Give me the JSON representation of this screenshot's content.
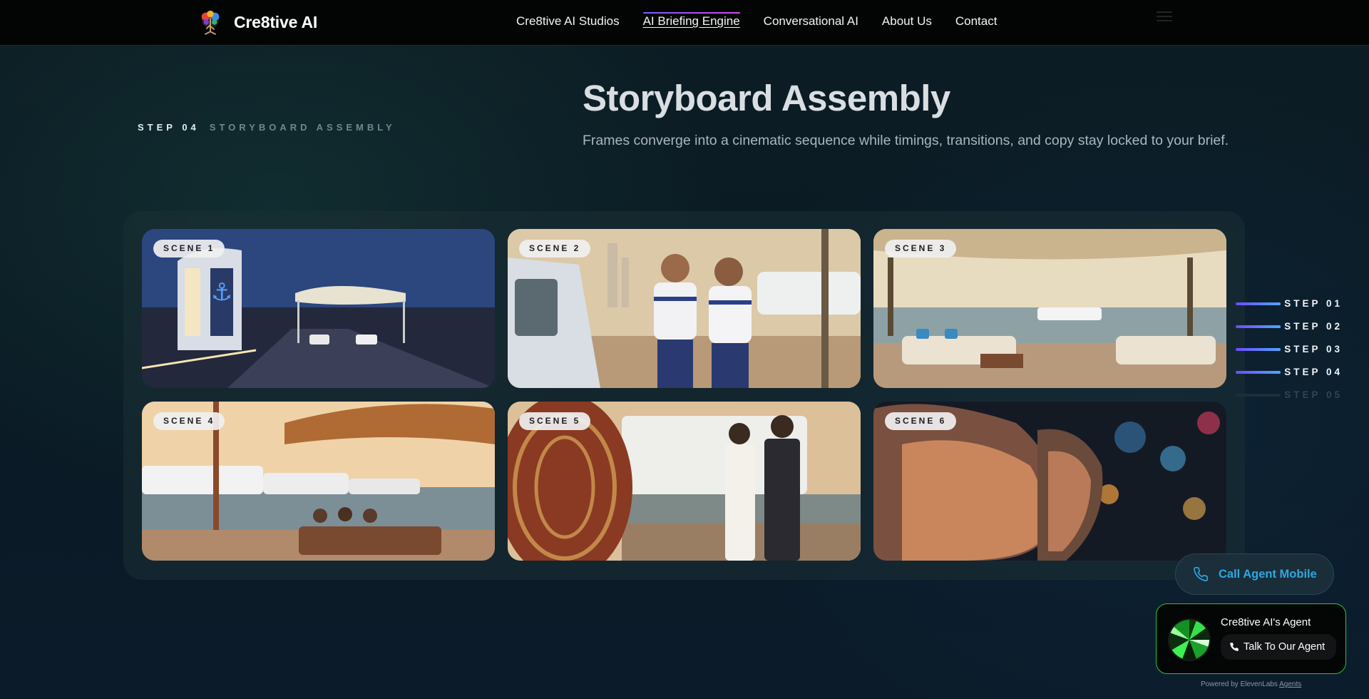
{
  "nav": {
    "brand": "Cre8tive AI",
    "links": [
      {
        "label": "Cre8tive AI Studios"
      },
      {
        "label": "AI Briefing Engine",
        "active": true
      },
      {
        "label": "Conversational AI"
      },
      {
        "label": "About Us"
      },
      {
        "label": "Contact"
      }
    ]
  },
  "section": {
    "step_number": "STEP 04",
    "step_label": "STORYBOARD ASSEMBLY",
    "title": "Storyboard Assembly",
    "subtitle": "Frames converge into a cinematic sequence while timings, transitions, and copy stay locked to your brief."
  },
  "scenes": [
    {
      "label": "SCENE 1"
    },
    {
      "label": "SCENE 2"
    },
    {
      "label": "SCENE 3"
    },
    {
      "label": "SCENE 4"
    },
    {
      "label": "SCENE 5"
    },
    {
      "label": "SCENE 6"
    }
  ],
  "steps": [
    {
      "label": "STEP 01",
      "active": true
    },
    {
      "label": "STEP 02",
      "active": true
    },
    {
      "label": "STEP 03",
      "active": true
    },
    {
      "label": "STEP 04",
      "active": true
    },
    {
      "label": "STEP 05",
      "active": false
    }
  ],
  "call_agent": {
    "label": "Call Agent Mobile",
    "icon": "phone-icon"
  },
  "agent_widget": {
    "name": "Cre8tive AI's Agent",
    "button_label": "Talk To Our Agent",
    "powered_prefix": "Powered by ElevenLabs",
    "powered_link": "Agents"
  },
  "colors": {
    "accent_blue": "#2fa7e0",
    "step_gradient_start": "#6d4cff",
    "step_gradient_end": "#4fa6ff",
    "agent_border": "#27c53c",
    "nav_active_underline": "#d946ef"
  }
}
